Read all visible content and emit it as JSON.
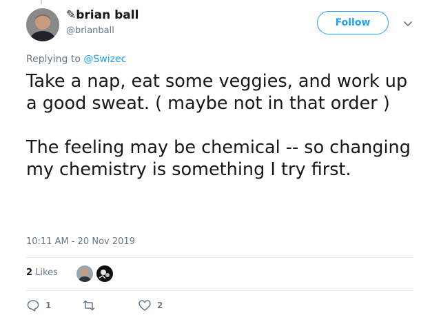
{
  "author": {
    "display_name": "✎brian ball",
    "handle": "@brianball"
  },
  "follow_button": {
    "label": "Follow"
  },
  "reply_context": {
    "prefix": "Replying to",
    "mention": "@Swizec"
  },
  "tweet": {
    "paragraphs": [
      "Take a nap, eat some veggies, and work up a good sweat. ( maybe not in that order )",
      "The feeling may be chemical -- so changing my chemistry is something I try first."
    ],
    "timestamp": "10:11 AM - 20 Nov 2019"
  },
  "stats": {
    "likes_count": "2",
    "likes_label": "Likes"
  },
  "actions": {
    "reply_count": "1",
    "retweet_count": "",
    "like_count": "2"
  },
  "icons": {
    "reply": "reply-icon",
    "retweet": "retweet-icon",
    "like": "heart-icon",
    "menu": "chevron-down-icon"
  },
  "colors": {
    "accent": "#1da1f2",
    "secondary_text": "#657786",
    "primary_text": "#14171a",
    "divider": "#e6ecf0"
  }
}
